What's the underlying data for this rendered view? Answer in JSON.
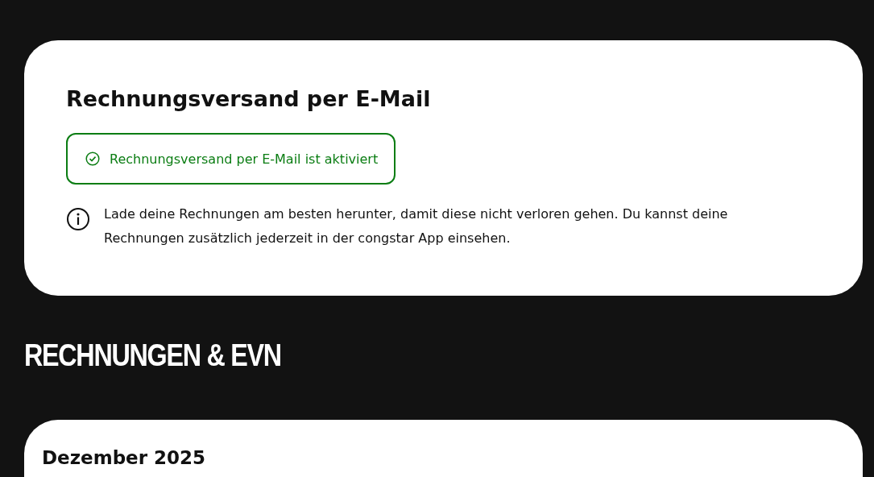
{
  "email_invoice_card": {
    "title": "Rechnungsversand per E-Mail",
    "status": {
      "text": "Rechnungsversand per E-Mail ist aktiviert",
      "active": true
    },
    "info": "Lade deine Rechnungen am besten herunter, damit diese nicht verloren gehen. Du kannst deine Rechnungen zusätzlich jederzeit in der congstar App einsehen."
  },
  "section_title": "RECHNUNGEN & EVN",
  "invoice_card": {
    "month": "Dezember 2025"
  }
}
